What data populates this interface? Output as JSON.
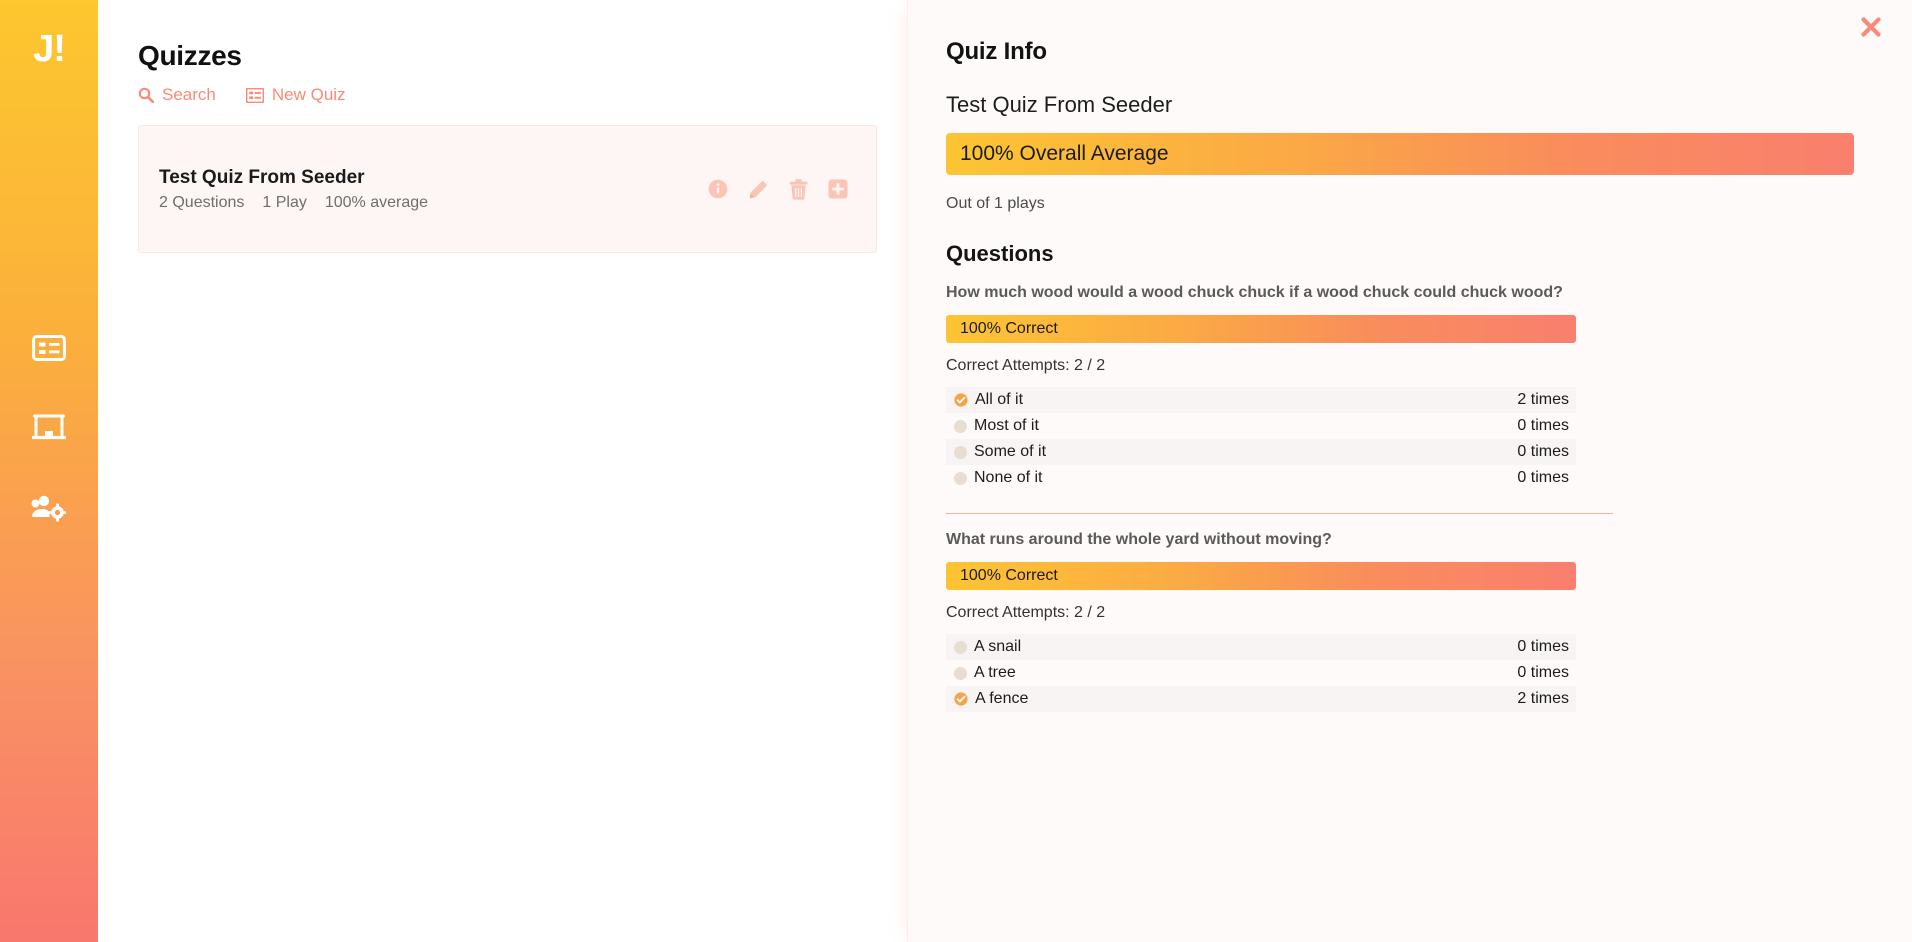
{
  "sidebar": {
    "brand": "J!",
    "items": [
      {
        "icon": "list-alt-icon",
        "name": "quizzes"
      },
      {
        "icon": "chalkboard-icon",
        "name": "presentations"
      },
      {
        "icon": "users-cog-icon",
        "name": "users"
      }
    ]
  },
  "content": {
    "page_title": "Quizzes",
    "toolbar": {
      "search_label": "Search",
      "new_quiz_label": "New Quiz"
    },
    "quiz_card": {
      "title": "Test Quiz From Seeder",
      "questions": "2 Questions",
      "plays": "1 Play",
      "average": "100% average",
      "actions": [
        {
          "icon": "info-circle-icon",
          "name": "quiz-info-button"
        },
        {
          "icon": "pencil-icon",
          "name": "quiz-edit-button"
        },
        {
          "icon": "trash-icon",
          "name": "quiz-delete-button"
        },
        {
          "icon": "plus-square-icon",
          "name": "quiz-add-button"
        }
      ]
    }
  },
  "panel": {
    "title": "Quiz Info",
    "quiz_name": "Test Quiz From Seeder",
    "overall_bar_label": "100% Overall Average",
    "plays_text": "Out of 1 plays",
    "questions_heading": "Questions",
    "close_icon": "close-icon",
    "questions": [
      {
        "text": "How much wood would a wood chuck chuck if a wood chuck could chuck wood?",
        "correct_bar_label": "100% Correct",
        "attempts_label": "Correct Attempts: 2 / 2",
        "answers": [
          {
            "label": "All of it",
            "count": "2 times",
            "correct": true
          },
          {
            "label": "Most of it",
            "count": "0 times",
            "correct": false
          },
          {
            "label": "Some of it",
            "count": "0 times",
            "correct": false
          },
          {
            "label": "None of it",
            "count": "0 times",
            "correct": false
          }
        ]
      },
      {
        "text": "What runs around the whole yard without moving?",
        "correct_bar_label": "100% Correct",
        "attempts_label": "Correct Attempts: 2 / 2",
        "answers": [
          {
            "label": "A snail",
            "count": "0 times",
            "correct": false
          },
          {
            "label": "A tree",
            "count": "0 times",
            "correct": false
          },
          {
            "label": "A fence",
            "count": "2 times",
            "correct": true
          }
        ]
      }
    ]
  },
  "colors": {
    "brand_gradient_start": "#fdc72f",
    "brand_gradient_end": "#f9776e",
    "accent_salmon": "#fa8a77",
    "bar_gradient_start": "#fcc533",
    "bar_gradient_end": "#f97f6e",
    "correct_marker": "#f5a44a",
    "bullet_neutral": "#e9dcd1"
  }
}
